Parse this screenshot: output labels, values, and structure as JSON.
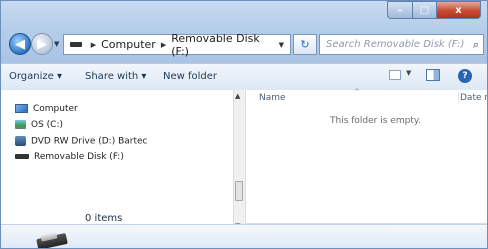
{
  "window": {
    "caption_buttons": {
      "minimize": "–",
      "maximize": "□",
      "close": "x"
    }
  },
  "nav": {
    "back_glyph": "◀",
    "forward_glyph": "▶",
    "address": {
      "segments": [
        "Computer",
        "Removable Disk (F:)"
      ],
      "separator": "▶",
      "dropdown": "▼"
    },
    "refresh_glyph": "↻",
    "search_placeholder": "Search Removable Disk (F:)",
    "search_glyph": "⌕"
  },
  "toolbar": {
    "organize": "Organize ▾",
    "share_with": "Share with ▾",
    "new_folder": "New folder",
    "help_glyph": "?"
  },
  "navpane": {
    "items": [
      {
        "label": "Computer",
        "icon": "computer-icon"
      },
      {
        "label": "OS (C:)",
        "icon": "drive-icon"
      },
      {
        "label": "DVD RW Drive (D:) Bartec",
        "icon": "dvd-drive-icon"
      },
      {
        "label": "Removable Disk (F:)",
        "icon": "removable-disk-icon"
      }
    ]
  },
  "content": {
    "columns": {
      "name": "Name",
      "date": "Date m"
    },
    "empty_message": "This folder is empty."
  },
  "details": {
    "item_count": "0 items",
    "icon": "removable-disk-icon"
  },
  "colors": {
    "frame": "#b4cde9",
    "accent": "#2b63b5",
    "close": "#c74c33"
  }
}
